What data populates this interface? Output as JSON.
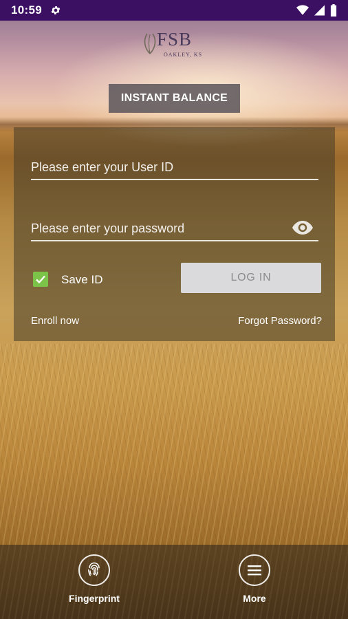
{
  "status_bar": {
    "time": "10:59"
  },
  "logo": {
    "name": "FSB",
    "location": "OAKLEY, KS"
  },
  "instant_balance": {
    "label": "INSTANT BALANCE"
  },
  "login": {
    "user_id_placeholder": "Please enter your User ID",
    "password_placeholder": "Please enter your password",
    "save_id_label": "Save ID",
    "save_id_checked": true,
    "login_label": "LOG IN",
    "enroll_label": "Enroll now",
    "forgot_label": "Forgot Password?"
  },
  "bottom_nav": {
    "items": [
      {
        "label": "Fingerprint",
        "icon": "fingerprint-icon"
      },
      {
        "label": "More",
        "icon": "menu-icon"
      }
    ]
  },
  "colors": {
    "status_bar": "#3b0f61",
    "checkbox": "#7cc34a",
    "login_button": "#dadadc"
  }
}
